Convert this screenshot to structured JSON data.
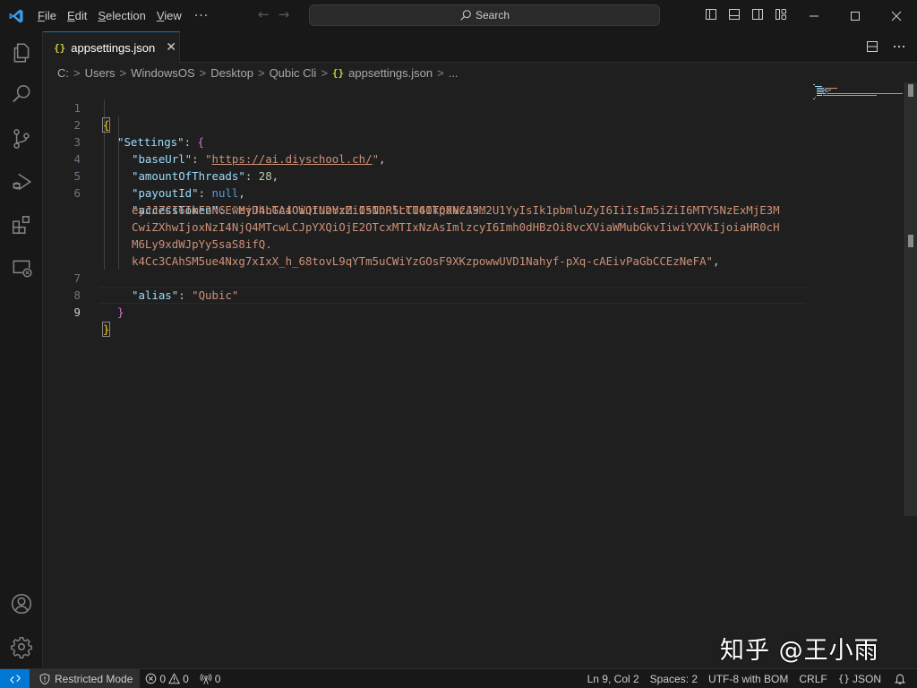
{
  "titlebar": {
    "menu": [
      {
        "label": "File",
        "mnemonic": "F",
        "rest": "ile"
      },
      {
        "label": "Edit",
        "mnemonic": "E",
        "rest": "dit"
      },
      {
        "label": "Selection",
        "mnemonic": "S",
        "rest": "election"
      },
      {
        "label": "View",
        "mnemonic": "V",
        "rest": "iew"
      }
    ],
    "more": "···",
    "back_arrow": "←",
    "forward_arrow": "→",
    "search_label": "Search"
  },
  "tabs": [
    {
      "icon": "{}",
      "label": "appsettings.json",
      "close": "✕",
      "active": true
    }
  ],
  "breadcrumb": {
    "items": [
      "C:",
      "Users",
      "WindowsOS",
      "Desktop",
      "Qubic Cli"
    ],
    "file_icon": "{}",
    "file": "appsettings.json",
    "tail": "...",
    "separator": ">"
  },
  "editor": {
    "line_numbers": [
      "1",
      "2",
      "3",
      "4",
      "5",
      "6",
      "7",
      "8",
      "9"
    ],
    "active_line": 9,
    "json": {
      "open_brace": "{",
      "close_brace": "}",
      "settings_key": "\"Settings\"",
      "settings_open": "{",
      "settings_close": "}",
      "base_url_key": "\"baseUrl\"",
      "base_url_q1": "\"",
      "base_url_value": "https://ai.diyschool.ch/",
      "base_url_q2": "\"",
      "threads_key": "\"amountOfThreads\"",
      "threads_value": "28",
      "payout_key": "\"payoutId\"",
      "payout_value": "null",
      "token_key": "\"accessToken\"",
      "token_lines": [
        "\"eyJhbGciOiJIUzUxMiIsInR5cCI6IkpXVCJ9.",
        "eyJJZCI6ImE2NGEwMjU4LTA4OWQtNDYzZi05NDRlLTU4OTQ0NzA3M2U1YyIsIk1pbmluZyI6IiIsIm5iZiI6MTY5NzExMjE3M",
        "CwiZXhwIjoxNzI4NjQ4MTcwLCJpYXQiOjE2OTcxMTIxNzAsImlzcyI6Imh0dHBzOi8vcXViaWMubGkvIiwiYXVkIjoiaHR0cH",
        "M6Ly9xdWJpYy5saS8ifQ.",
        "k4Cc3CAhSM5ue4Nxg7xIxX_h_68tovL9qYTm5uCWiYzGOsF9XKzpowwUVD1Nahyf-pXq-cAEivPaGbCCEzNeFA\""
      ],
      "alias_key": "\"alias\"",
      "alias_value": "\"Qubic\"",
      "colon": ": ",
      "comma": ","
    }
  },
  "watermark": "知乎 @王小雨",
  "statusbar": {
    "restricted_mode": "Restricted Mode",
    "errors": "0",
    "warnings": "0",
    "ports": "0",
    "cursor": "Ln 9, Col 2",
    "indent": "Spaces: 2",
    "encoding": "UTF-8 with BOM",
    "eol": "CRLF",
    "language_icon": "{}",
    "language": "JSON"
  },
  "colors": {
    "accent": "#0078d4",
    "string": "#ce9178",
    "key": "#9cdcfe",
    "number": "#b5cea8",
    "keyword": "#569cd6",
    "bracket_level1": "#ffd700",
    "bracket_level2": "#da70d6",
    "json_icon": "#cbcb41"
  }
}
